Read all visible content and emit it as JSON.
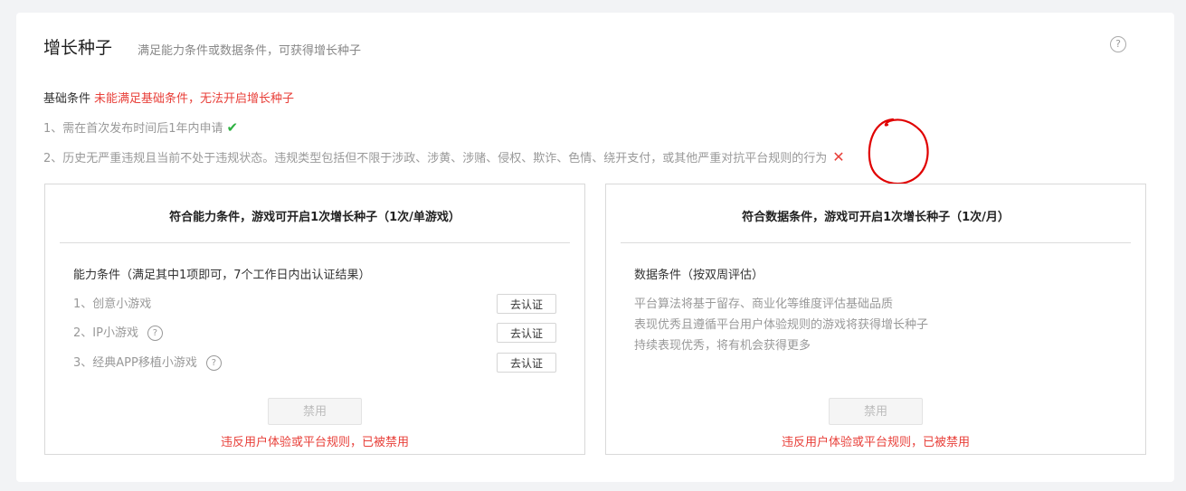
{
  "header": {
    "title": "增长种子",
    "subtitle": "满足能力条件或数据条件，可获得增长种子",
    "help_icon": "?"
  },
  "basic": {
    "label": "基础条件",
    "warning": "未能满足基础条件，无法开启增长种子",
    "requirements": [
      {
        "text": "1、需在首次发布时间后1年内申请",
        "status": "✔"
      },
      {
        "text": "2、历史无严重违规且当前不处于违规状态。违规类型包括但不限于涉政、涉黄、涉赌、侵权、欺诈、色情、绕开支付，或其他严重对抗平台规则的行为",
        "status": "✕"
      }
    ]
  },
  "ability_panel": {
    "heading": "符合能力条件，游戏可开启1次增长种子（1次/单游戏）",
    "section_title": "能力条件（满足其中1项即可，7个工作日内出认证结果）",
    "conditions": [
      {
        "label": "1、创意小游戏",
        "button": "去认证"
      },
      {
        "label": "2、IP小游戏",
        "button": "去认证",
        "help": "?"
      },
      {
        "label": "3、经典APP移植小游戏",
        "button": "去认证",
        "help": "?"
      }
    ],
    "disabled_button": "禁用",
    "violation": "违反用户体验或平台规则，已被禁用"
  },
  "data_panel": {
    "heading": "符合数据条件，游戏可开启1次增长种子（1次/月）",
    "section_title": "数据条件（按双周评估）",
    "lines": [
      "平台算法将基于留存、商业化等维度评估基础品质",
      "表现优秀且遵循平台用户体验规则的游戏将获得增长种子",
      "持续表现优秀，将有机会获得更多"
    ],
    "disabled_button": "禁用",
    "violation": "违反用户体验或平台规则，已被禁用"
  },
  "colors": {
    "error": "#e8403a",
    "success": "#2db141",
    "annotation": "#e00000"
  }
}
